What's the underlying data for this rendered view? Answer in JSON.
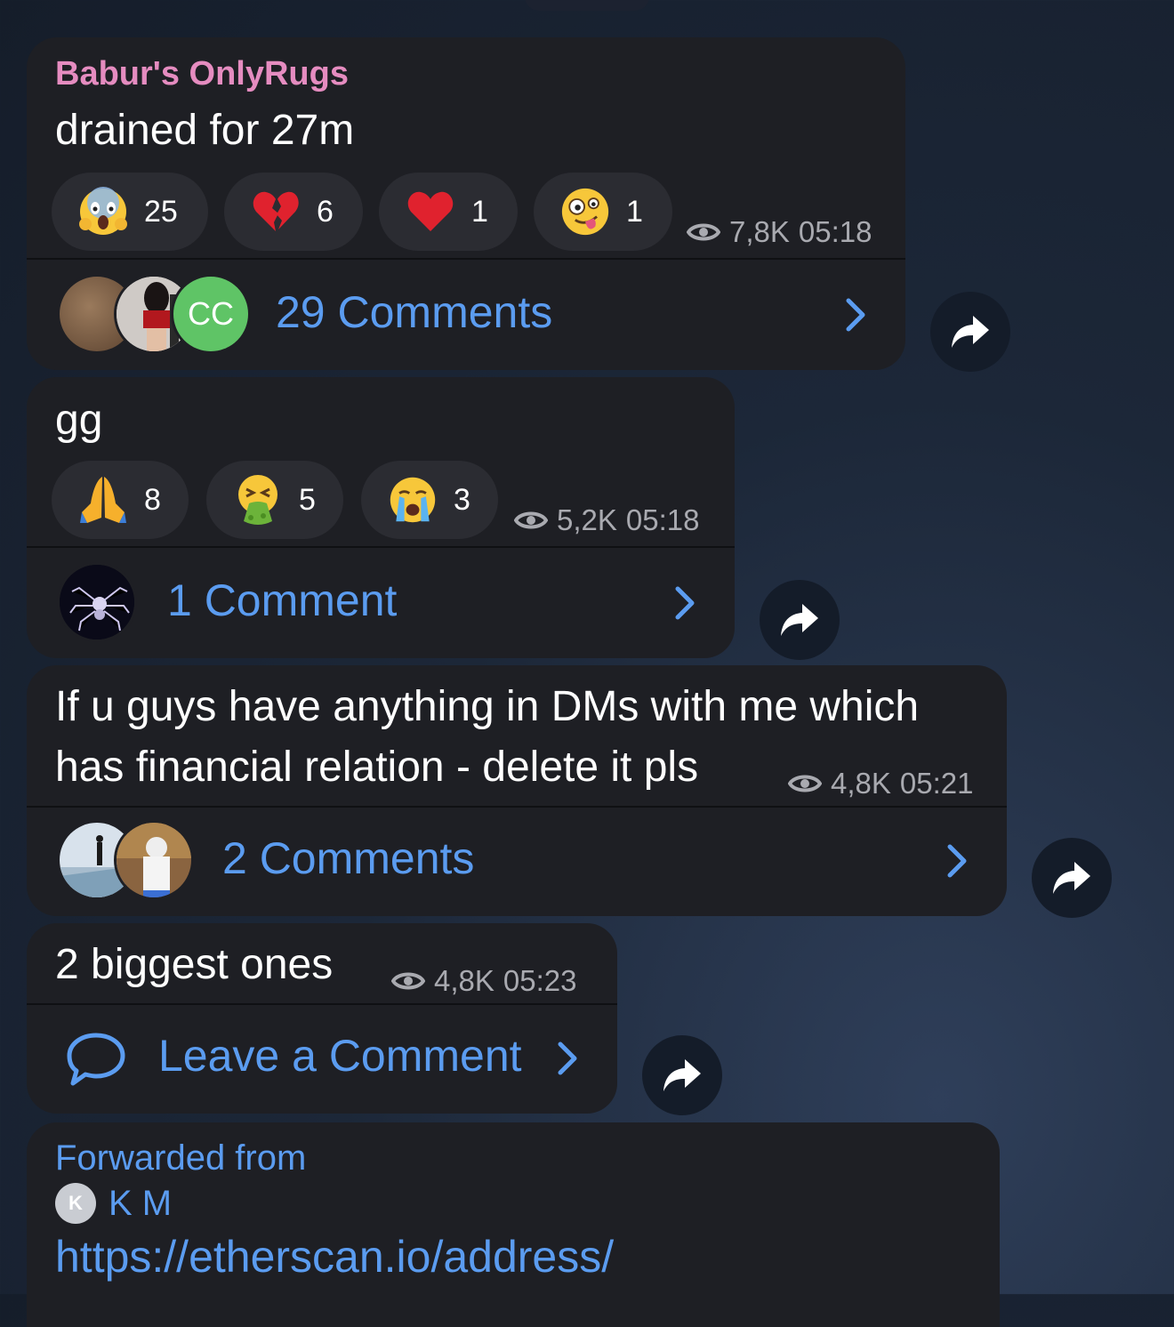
{
  "posts": [
    {
      "sender": "Babur's OnlyRugs",
      "text": "drained for 27m",
      "reactions": [
        {
          "emoji": "face-screaming-in-fear",
          "count": "25"
        },
        {
          "emoji": "broken-heart",
          "count": "6"
        },
        {
          "emoji": "red-heart",
          "count": "1"
        },
        {
          "emoji": "zany-face",
          "count": "1"
        }
      ],
      "views": "7,8K",
      "time": "05:18",
      "comments_label": "29 Comments",
      "comment_avatar_initials": "CC"
    },
    {
      "text": "gg",
      "reactions": [
        {
          "emoji": "folded-hands",
          "count": "8"
        },
        {
          "emoji": "face-vomiting",
          "count": "5"
        },
        {
          "emoji": "loudly-crying-face",
          "count": "3"
        }
      ],
      "views": "5,2K",
      "time": "05:18",
      "comments_label": "1 Comment"
    },
    {
      "text_line1": "If u guys have anything in DMs with me which",
      "text_line2": "has financial relation - delete it pls",
      "views": "4,8K",
      "time": "05:21",
      "comments_label": "2 Comments"
    },
    {
      "text": "2 biggest ones",
      "views": "4,8K",
      "time": "05:23",
      "comments_label": "Leave a Comment"
    }
  ],
  "forwarded": {
    "label": "Forwarded from",
    "avatar_initial": "K",
    "author": "K M",
    "link": "https://etherscan.io/address/"
  },
  "colors": {
    "accent": "#5b9cf0",
    "sender": "#e58cc0",
    "bubble": "#1e1f24",
    "reaction_bg": "#2b2c32",
    "meta": "#a9aab0"
  }
}
